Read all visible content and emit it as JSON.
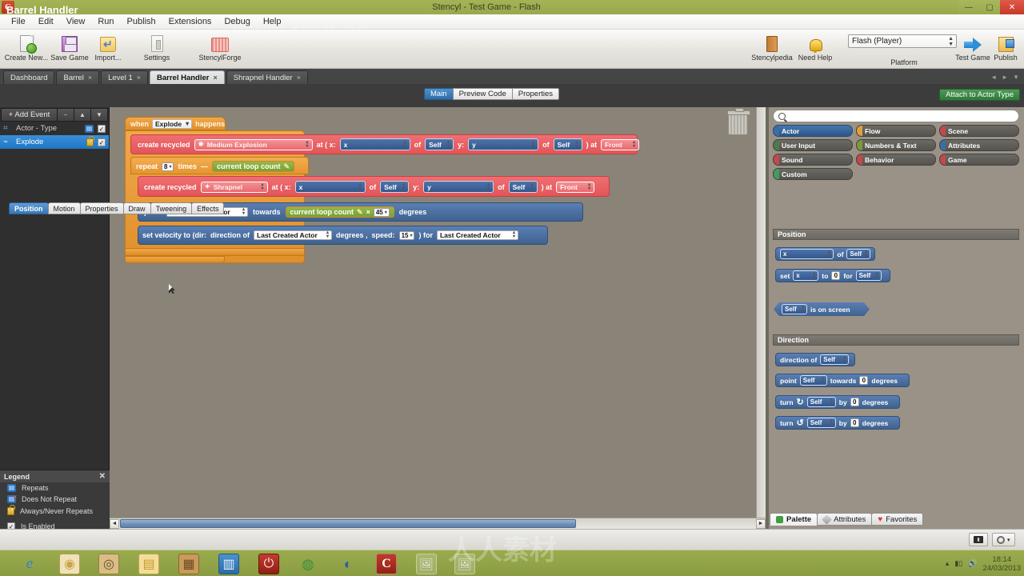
{
  "window": {
    "title": "Stencyl - Test Game - Flash",
    "app_initial": "C",
    "minimize": "—",
    "maximize": "▢",
    "close": "✕"
  },
  "watermark": {
    "url": "www.rrcg.cn"
  },
  "menubar": {
    "items": [
      "File",
      "Edit",
      "View",
      "Run",
      "Publish",
      "Extensions",
      "Debug",
      "Help"
    ]
  },
  "toolbar": {
    "left_items": [
      {
        "label": "Create New...",
        "icon": "new-file-icon"
      },
      {
        "label": "Save Game",
        "icon": "floppy-disk-icon"
      },
      {
        "label": "Import...",
        "icon": "import-icon"
      },
      {
        "label": "Settings",
        "icon": "settings-icon"
      },
      {
        "label": "StencylForge",
        "icon": "forge-icon"
      }
    ],
    "right_items": [
      {
        "label": "Stencylpedia",
        "icon": "book-icon"
      },
      {
        "label": "Need Help",
        "icon": "bell-icon"
      },
      {
        "label": "Test Game",
        "icon": "arrow-right-icon"
      },
      {
        "label": "Publish",
        "icon": "publish-box-icon"
      }
    ],
    "platform": {
      "value": "Flash (Player)",
      "label": "Platform"
    }
  },
  "editor_tabs": {
    "items": [
      {
        "label": "Dashboard",
        "closable": false,
        "active": false
      },
      {
        "label": "Barrel",
        "closable": true,
        "active": false
      },
      {
        "label": "Level 1",
        "closable": true,
        "active": false
      },
      {
        "label": "Barrel Handler",
        "closable": true,
        "active": true
      },
      {
        "label": "Shrapnel Handler",
        "closable": true,
        "active": false
      }
    ],
    "close_glyph": "×",
    "nav": [
      "◄",
      "►",
      "▼"
    ]
  },
  "header": {
    "page_title": "Barrel Handler",
    "center_tabs": [
      {
        "label": "Main",
        "active": true
      },
      {
        "label": "Preview Code",
        "active": false
      },
      {
        "label": "Properties",
        "active": false
      }
    ],
    "attach_button": "Attach to Actor Type"
  },
  "sidebar": {
    "add_event": "+ Add Event",
    "buttons": [
      "−",
      "▲",
      "▼"
    ],
    "events": [
      {
        "label": "Actor - Type",
        "icon": "actor-type-icon",
        "repeat_icon": "repeats-icon",
        "enabled": "☑",
        "selected": false
      },
      {
        "label": "Explode",
        "icon": "explode-event-icon",
        "repeat_icon": "always-never-repeats-icon",
        "enabled": "☑",
        "selected": true
      }
    ]
  },
  "legend": {
    "title": "Legend",
    "close": "✕",
    "rows": [
      {
        "label": "Repeats",
        "icon": "repeats-icon"
      },
      {
        "label": "Does Not Repeat",
        "icon": "does-not-repeat-icon"
      },
      {
        "label": "Always/Never Repeats",
        "icon": "lock-icon"
      },
      {
        "label": "Is Enabled",
        "icon": "checkbox-icon"
      }
    ]
  },
  "canvas": {
    "trash_icon": "trash-can-icon",
    "scrollbar": {
      "left_arrow": "◄",
      "right_arrow": "►"
    },
    "script": {
      "hat": {
        "prefix": "when",
        "event": "Explode",
        "suffix": "happens"
      },
      "create_explosion": {
        "label": "create recycled",
        "actor": "Medium Explosion",
        "at_open": "at ( x:",
        "x_value": "x",
        "of1": "of",
        "self1": "Self",
        "y_label": "y:",
        "y_value": "y",
        "of2": "of",
        "self2": "Self",
        "close": ") at",
        "layer": "Front"
      },
      "repeat": {
        "label": "repeat",
        "times_value": "8",
        "times_label": "times",
        "dash": "—",
        "loop_token": "current loop count",
        "pencil": "✎"
      },
      "create_shrapnel": {
        "label": "create recycled",
        "actor": "Shrapnel",
        "at_open": "at ( x:",
        "x_value": "x",
        "of1": "of",
        "self1": "Self",
        "y_label": "y:",
        "y_value": "y",
        "of2": "of",
        "self2": "Self",
        "close": ") at",
        "layer": "Front"
      },
      "point_block": {
        "label": "point",
        "target": "Last Created Actor",
        "towards": "towards",
        "loop_token": "current loop count",
        "pencil": "✎",
        "times_sign": "×",
        "multiplier": "45",
        "degrees": "degrees"
      },
      "velocity_block": {
        "label": "set velocity to (dir:",
        "direction_of": "direction of",
        "direction_actor": "Last Created Actor",
        "degrees": "degrees ,",
        "speed_label": "speed:",
        "speed_value": "15",
        "close": ") for",
        "for_actor": "Last Created Actor"
      }
    }
  },
  "palette": {
    "search_placeholder": "",
    "search_icon": "search-icon",
    "categories": [
      {
        "label": "Actor",
        "color": "#3a6ea5",
        "active": true
      },
      {
        "label": "Flow",
        "color": "#e0a03c",
        "active": false
      },
      {
        "label": "Scene",
        "color": "#c2484d",
        "active": false
      },
      {
        "label": "User Input",
        "color": "#4e7a4e",
        "active": false
      },
      {
        "label": "Numbers & Text",
        "color": "#7c9a3c",
        "active": false
      },
      {
        "label": "Attributes",
        "color": "#3a6ea5",
        "active": false
      },
      {
        "label": "Sound",
        "color": "#c2484d",
        "active": false
      },
      {
        "label": "Behavior",
        "color": "#c2484d",
        "active": false
      },
      {
        "label": "Game",
        "color": "#c2484d",
        "active": false
      },
      {
        "label": "Custom",
        "color": "#3f9e5c",
        "active": false
      }
    ],
    "subtabs": [
      {
        "label": "Position",
        "active": true
      },
      {
        "label": "Motion",
        "active": false
      },
      {
        "label": "Properties",
        "active": false
      },
      {
        "label": "Draw",
        "active": false
      },
      {
        "label": "Tweening",
        "active": false
      },
      {
        "label": "Effects",
        "active": false
      }
    ],
    "sections": [
      {
        "title": "Position",
        "blocks": [
          {
            "kind": "getter",
            "parts": [
              "x",
              "of",
              "Self"
            ]
          },
          {
            "kind": "setter",
            "parts": [
              "set",
              "x",
              "to",
              "0",
              "for",
              "Self"
            ]
          },
          {
            "kind": "condition",
            "parts": [
              "Self",
              "is on screen"
            ]
          }
        ]
      },
      {
        "title": "Direction",
        "blocks": [
          {
            "kind": "getter",
            "parts": [
              "direction of",
              "Self"
            ]
          },
          {
            "kind": "action",
            "parts": [
              "point",
              "Self",
              "towards",
              "0",
              "degrees"
            ]
          },
          {
            "kind": "action",
            "parts": [
              "turn",
              "↻",
              "Self",
              "by",
              "0",
              "degrees"
            ]
          },
          {
            "kind": "action",
            "parts": [
              "turn",
              "↺",
              "Self",
              "by",
              "0",
              "degrees"
            ]
          }
        ]
      }
    ],
    "bottom_tabs": [
      {
        "label": "Palette",
        "icon": "puzzle-icon",
        "active": true
      },
      {
        "label": "Attributes",
        "icon": "pencil-icon",
        "active": false
      },
      {
        "label": "Favorites",
        "icon": "heart-icon",
        "active": false
      }
    ]
  },
  "statusbar": {
    "console_icon": "console-icon",
    "gear_icon": "gear-icon",
    "gear_caret": "▾"
  },
  "taskbar": {
    "items": [
      {
        "name": "internet-explorer-icon",
        "glyph": "e",
        "color": "#2b7fd4",
        "pinned": false
      },
      {
        "name": "media-app-icon",
        "glyph": "◉",
        "color": "#c8a44a",
        "pinned": false
      },
      {
        "name": "speaker-app-icon",
        "glyph": "◎",
        "color": "#8a6a38",
        "pinned": false
      },
      {
        "name": "file-explorer-icon",
        "glyph": "🗀",
        "color": "#e3c05a",
        "pinned": false
      },
      {
        "name": "toolbox-icon",
        "glyph": "▤",
        "color": "#b07a3a",
        "pinned": false
      },
      {
        "name": "settings-app-icon",
        "glyph": "▥",
        "color": "#2e6ea8",
        "pinned": false
      },
      {
        "name": "power-icon",
        "glyph": "⏻",
        "color": "#b02a2a",
        "pinned": false
      },
      {
        "name": "chrome-icon",
        "glyph": "◍",
        "color": "#3c8f3c",
        "pinned": false
      },
      {
        "name": "firefox-icon",
        "glyph": "◐",
        "color": "#2b5fa8",
        "pinned": false
      },
      {
        "name": "stencyl-icon",
        "glyph": "C",
        "color": "#c03a2a",
        "pinned": true
      },
      {
        "name": "image-window-icon",
        "glyph": "🖼",
        "color": "#5a7a4a",
        "pinned": true
      },
      {
        "name": "image-window-2-icon",
        "glyph": "🖼",
        "color": "#5a7a4a",
        "pinned": true
      }
    ],
    "tray": {
      "show_hidden": "▴",
      "network_icon": "network-icon",
      "volume_icon": "volume-icon",
      "time": "18:14",
      "date": "24/03/2013"
    }
  }
}
